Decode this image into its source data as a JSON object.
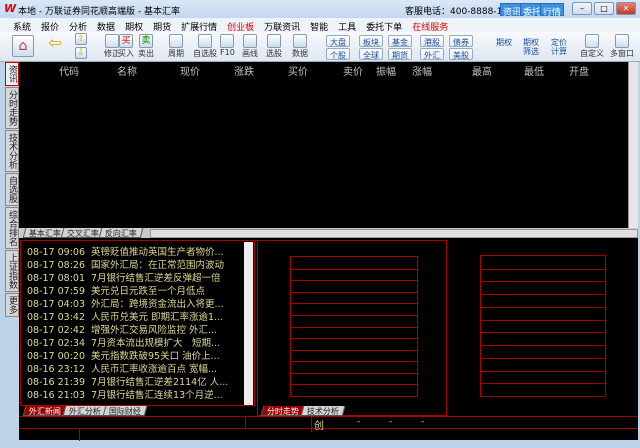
{
  "window": {
    "logo": "W",
    "title": "本地 - 万联证券同花顺高端版 - 基本汇率",
    "phone": "客服电话：400-8888-133",
    "buttons": [
      "资讯",
      "委托",
      "行情"
    ]
  },
  "menu": [
    "系统",
    "报价",
    "分析",
    "数据",
    "期权",
    "期货",
    "扩展行情",
    "创业板",
    "万联资讯",
    "智能",
    "工具",
    "委托下单",
    "在线服务"
  ],
  "menu_red": [
    "创业板",
    "在线服务"
  ],
  "toolbar": {
    "buttons": [
      "修正",
      "买入",
      "卖出",
      "周期",
      "自选股",
      "F10",
      "画线",
      "选股",
      "数据",
      "期权",
      "期权筛选",
      "定价计算",
      "自定义",
      "多窗口"
    ],
    "small": [
      "大盘",
      "板块",
      "基金",
      "港股",
      "债券",
      "个股",
      "全球",
      "期货",
      "外汇",
      "美股"
    ]
  },
  "sidetabs": [
    "资讯",
    "分时走势",
    "技术分析",
    "自选股",
    "综合排名",
    "上证指数",
    "更多"
  ],
  "grid": {
    "columns": [
      "代码",
      "名称",
      "现价",
      "涨跌",
      "买价",
      "卖价",
      "振幅",
      "涨幅",
      "最高",
      "最低",
      "开盘"
    ]
  },
  "sheet_tabs": [
    "基本汇率",
    "交叉汇率",
    "反向汇率"
  ],
  "news": [
    {
      "time": "08-17 09:06",
      "title": "英镑贬值推动英国生产者物价..."
    },
    {
      "time": "08-17 08:26",
      "title": "国家外汇局：在正常范围内波动"
    },
    {
      "time": "08-17 08:01",
      "title": "7月银行结售汇逆差反弹超一倍"
    },
    {
      "time": "08-17 07:59",
      "title": "美元兑日元跌至一个月低点"
    },
    {
      "time": "08-17 04:03",
      "title": "外汇局：跨境资金流出入将更..."
    },
    {
      "time": "08-17 03:42",
      "title": "人民币兑美元 即期汇率涨逾1..."
    },
    {
      "time": "08-17 02:42",
      "title": "增强外汇交易风险监控 外汇..."
    },
    {
      "time": "08-17 02:34",
      "title": "7月资本流出规模扩大　短期..."
    },
    {
      "time": "08-17 00:20",
      "title": "美元指数跌破95关口 油价上..."
    },
    {
      "time": "08-16 23:12",
      "title": "人民币汇率收涨逾百点 宽幅..."
    },
    {
      "time": "08-16 21:39",
      "title": "7月银行结售汇逆差2114亿 人..."
    },
    {
      "time": "08-16 21:03",
      "title": "7月银行结售汇连续13个月逆..."
    }
  ],
  "news_tabs": [
    "外汇新闻",
    "外汇分析",
    "国际财经"
  ],
  "chart_tabs": [
    "分时走势",
    "技术分析"
  ],
  "status": {
    "label": "创",
    "dashes": [
      "-",
      "-",
      "-"
    ]
  }
}
